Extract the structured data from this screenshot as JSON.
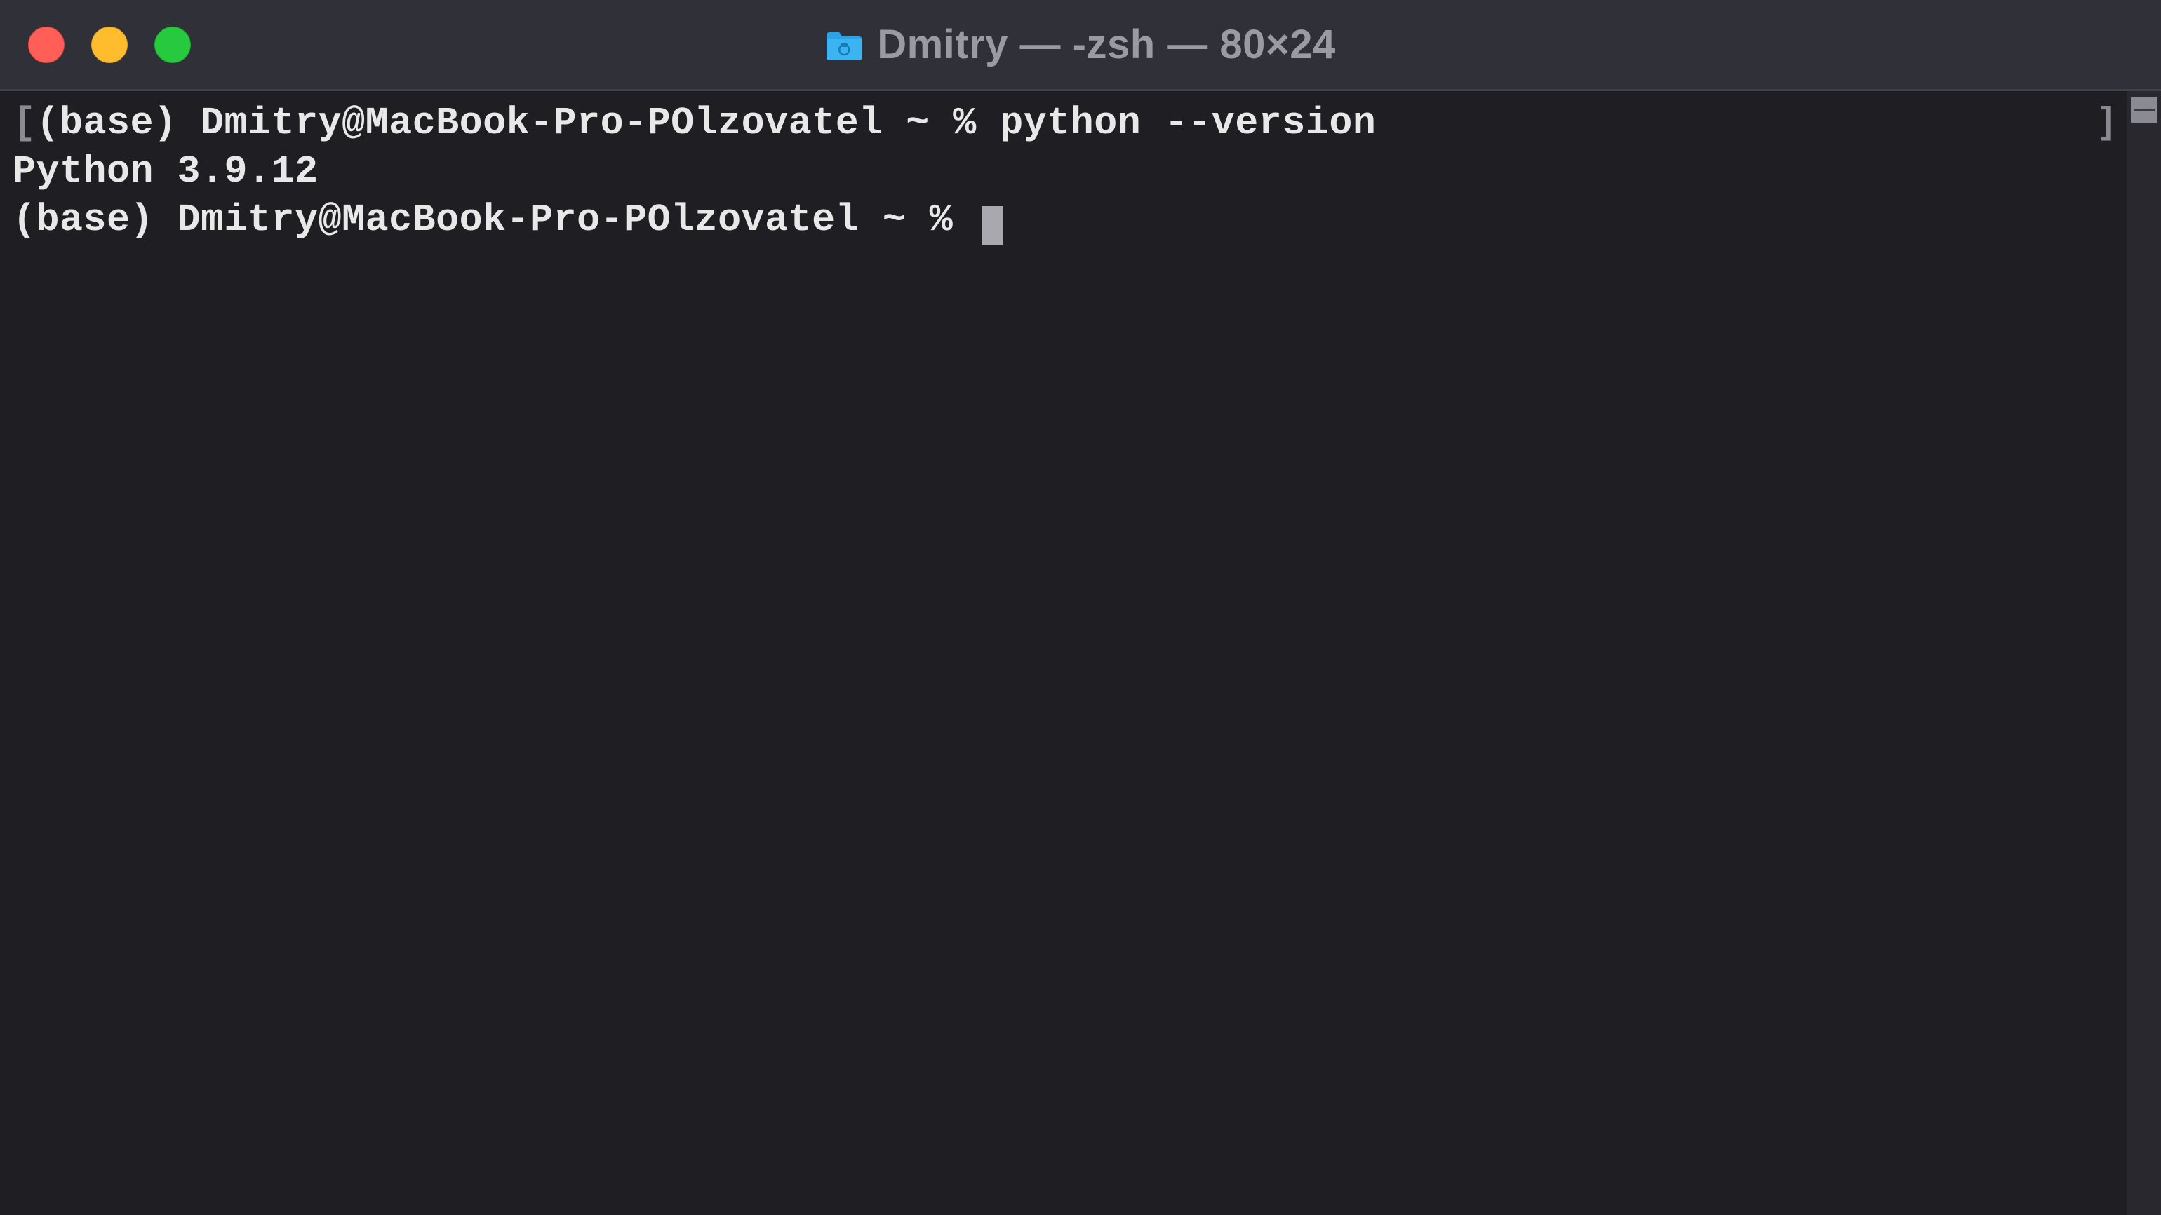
{
  "window": {
    "title": "Dmitry — -zsh — 80×24"
  },
  "terminal": {
    "lines": [
      {
        "bracket_left": "[",
        "prompt": "(base) Dmitry@MacBook-Pro-POlzovatel ~ % ",
        "command": "python --version"
      },
      {
        "output": "Python 3.9.12"
      },
      {
        "prompt": "(base) Dmitry@MacBook-Pro-POlzovatel ~ % ",
        "cursor": true
      }
    ],
    "bracket_right": "]"
  }
}
